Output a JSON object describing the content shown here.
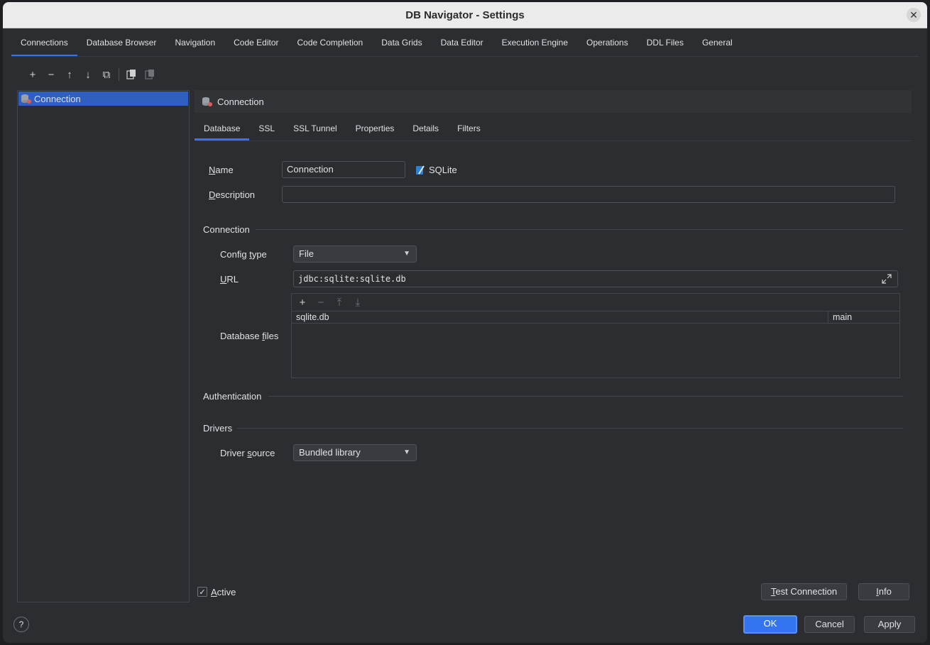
{
  "window": {
    "title": "DB Navigator - Settings"
  },
  "main_tabs": [
    {
      "label": "Connections",
      "active": true
    },
    {
      "label": "Database Browser"
    },
    {
      "label": "Navigation"
    },
    {
      "label": "Code Editor"
    },
    {
      "label": "Code Completion"
    },
    {
      "label": "Data Grids"
    },
    {
      "label": "Data Editor"
    },
    {
      "label": "Execution Engine"
    },
    {
      "label": "Operations"
    },
    {
      "label": "DDL Files"
    },
    {
      "label": "General"
    }
  ],
  "toolbar": {
    "add": "+",
    "remove": "−",
    "up": "↑",
    "down": "↓",
    "duplicate": "⧉"
  },
  "tree": {
    "items": [
      {
        "label": "Connection",
        "selected": true
      }
    ]
  },
  "panel": {
    "header": "Connection",
    "sub_tabs": [
      {
        "label": "Database",
        "active": true
      },
      {
        "label": "SSL"
      },
      {
        "label": "SSL Tunnel"
      },
      {
        "label": "Properties"
      },
      {
        "label": "Details"
      },
      {
        "label": "Filters"
      }
    ],
    "name_label_u": "N",
    "name_label_rest": "ame",
    "name_value": "Connection",
    "db_type": "SQLite",
    "description_label_u": "D",
    "description_label_rest": "escription",
    "description_value": "",
    "connection_section": "Connection",
    "config_type_label_pre": "Config ",
    "config_type_label_u": "t",
    "config_type_label_rest": "ype",
    "config_type_value": "File",
    "url_label_u": "U",
    "url_label_rest": "RL",
    "url_value": "jdbc:sqlite:sqlite.db",
    "database_files_label_pre": "Database ",
    "database_files_label_u": "f",
    "database_files_label_rest": "iles",
    "files": [
      {
        "path": "sqlite.db",
        "schema": "main"
      }
    ],
    "authentication_section": "Authentication",
    "drivers_section": "Drivers",
    "driver_source_label_pre": "Driver ",
    "driver_source_label_u": "s",
    "driver_source_label_rest": "ource",
    "driver_source_value": "Bundled library"
  },
  "footer": {
    "active_label_u": "A",
    "active_label_rest": "ctive",
    "active_checked": true,
    "check_mark": "✓",
    "test_connection_u": "T",
    "test_connection_rest": "est Connection",
    "info_u": "I",
    "info_rest": "nfo",
    "ok": "OK",
    "cancel": "Cancel",
    "apply": "Apply",
    "help": "?"
  },
  "colors": {
    "accent": "#3574f0",
    "background": "#2b2d30",
    "selection": "#2e5fc1"
  }
}
